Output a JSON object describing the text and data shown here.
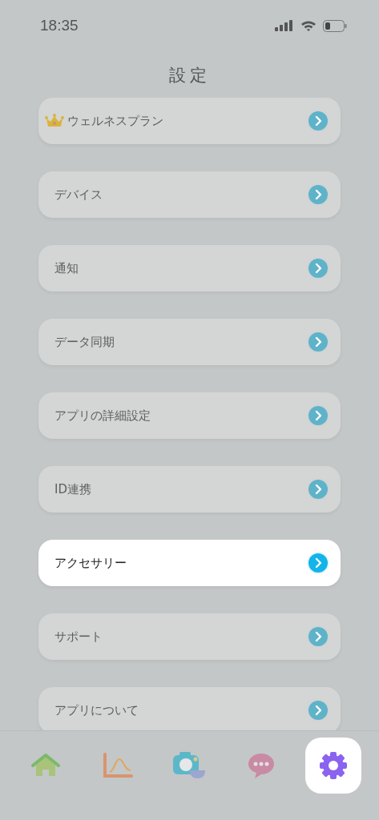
{
  "status_bar": {
    "time": "18:35"
  },
  "title": "設定",
  "items": [
    {
      "label": "ウェルネスプラン",
      "kind": "premium",
      "highlighted": false
    },
    {
      "label": "デバイス",
      "kind": "plain",
      "highlighted": false
    },
    {
      "label": "通知",
      "kind": "plain",
      "highlighted": false
    },
    {
      "label": "データ同期",
      "kind": "plain",
      "highlighted": false
    },
    {
      "label": "アプリの詳細設定",
      "kind": "plain",
      "highlighted": false
    },
    {
      "label": "ID連携",
      "kind": "plain",
      "highlighted": false
    },
    {
      "label": "アクセサリー",
      "kind": "plain",
      "highlighted": true
    },
    {
      "label": "サポート",
      "kind": "plain",
      "highlighted": false
    },
    {
      "label": "アプリについて",
      "kind": "plain",
      "highlighted": false
    }
  ],
  "tabs": [
    {
      "kind": "home",
      "selected": false
    },
    {
      "kind": "chart",
      "selected": false
    },
    {
      "kind": "camera",
      "selected": false
    },
    {
      "kind": "chat",
      "selected": false
    },
    {
      "kind": "settings",
      "selected": true
    }
  ]
}
